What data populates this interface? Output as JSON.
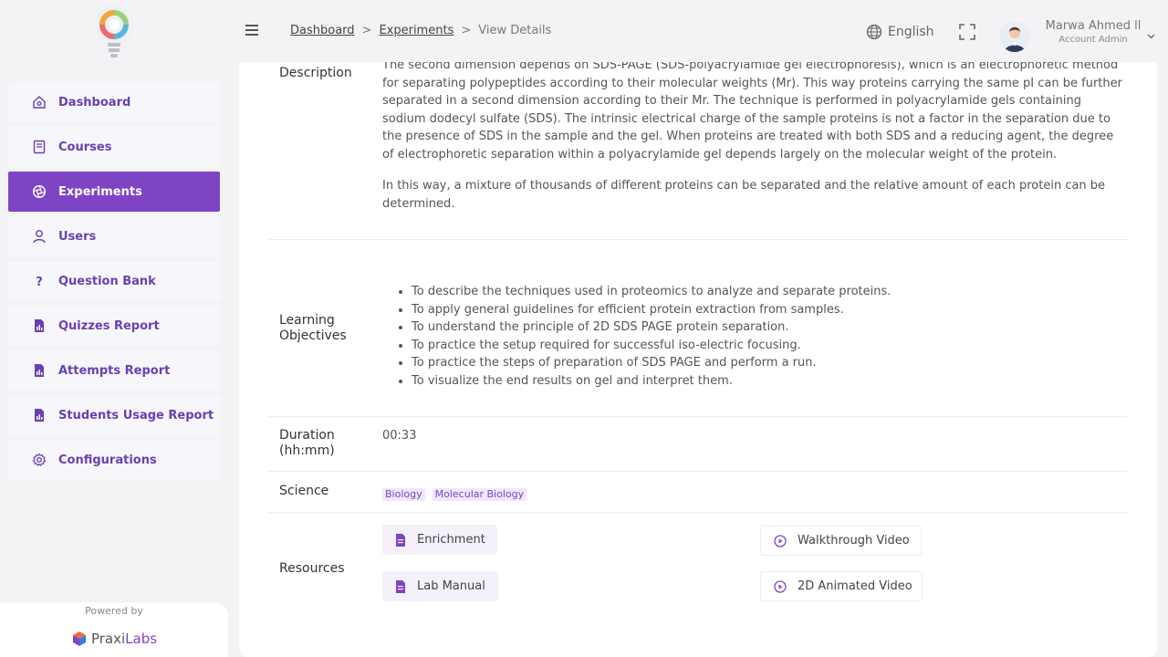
{
  "colors": {
    "accent": "#7e44c4",
    "accent_light": "#efe7fa",
    "text": "#444444"
  },
  "sidebar": {
    "logo_icon": "lightbulb-logo-icon",
    "items": [
      {
        "label": "Dashboard",
        "icon": "home-icon"
      },
      {
        "label": "Courses",
        "icon": "book-icon"
      },
      {
        "label": "Experiments",
        "icon": "aperture-icon"
      },
      {
        "label": "Users",
        "icon": "user-icon"
      },
      {
        "label": "Question Bank",
        "icon": "question-icon"
      },
      {
        "label": "Quizzes Report",
        "icon": "report-icon"
      },
      {
        "label": "Attempts Report",
        "icon": "report-icon"
      },
      {
        "label": "Students Usage Report",
        "icon": "report-icon"
      },
      {
        "label": "Configurations",
        "icon": "gear-icon"
      }
    ],
    "active_index": 2,
    "powered_by": "Powered by",
    "brand_prefix": "Praxi",
    "brand_suffix": "Labs"
  },
  "header": {
    "breadcrumb": {
      "home": "Dashboard",
      "parent": "Experiments",
      "current": "View Details",
      "separator": ">"
    },
    "language": "English",
    "user": {
      "name": "Marwa Ahmed ll",
      "role": "Account Admin"
    }
  },
  "details": {
    "description_label": "Description",
    "description_p1": "The second dimension depends on SDS-PAGE (SDS-polyacrylamide gel electrophoresis), which is an electrophoretic method for separating polypeptides according to their molecular weights (Mr). This way proteins carrying the same pI can be further separated in a second dimension according to their Mr. The technique is performed in polyacrylamide gels containing sodium dodecyl sulfate (SDS). The intrinsic electrical charge of the sample proteins is not a factor in the separation due to the presence of SDS in the sample and the gel. When proteins are treated with both SDS and a reducing agent, the degree of electrophoretic separation within a polyacrylamide gel depends largely on the molecular weight of the protein.",
    "description_p2": "In this way, a mixture of thousands of different proteins can be separated and the relative amount of each protein can be determined.",
    "objectives_label_line1": "Learning",
    "objectives_label_line2": "Objectives",
    "objectives": [
      "To describe the techniques used in proteomics to analyze and separate proteins.",
      "To apply general guidelines for efficient protein extraction from samples.",
      "To understand the principle of 2D SDS PAGE protein separation.",
      "To practice the setup required for successful iso-electric focusing.",
      "To practice the steps of preparation of SDS PAGE and perform a run.",
      "To visualize the end results on gel and interpret them."
    ],
    "duration_label_line1": "Duration",
    "duration_label_line2": "(hh:mm)",
    "duration": "00:33",
    "science_label": "Science",
    "sciences": [
      "Biology",
      "Molecular Biology"
    ],
    "resources_label": "Resources",
    "resources": {
      "enrichment": "Enrichment",
      "lab_manual": "Lab Manual",
      "walkthrough": "Walkthrough Video",
      "animated": "2D Animated Video"
    }
  }
}
